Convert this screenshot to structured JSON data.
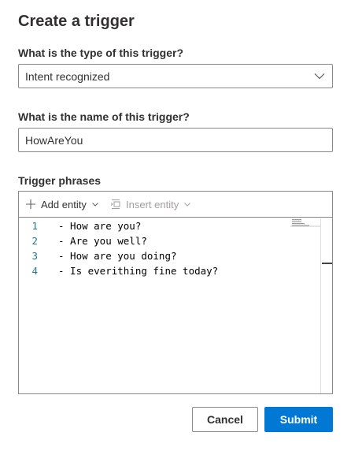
{
  "dialog": {
    "title": "Create a trigger"
  },
  "trigger_type": {
    "label": "What is the type of this trigger?",
    "value": "Intent recognized"
  },
  "trigger_name": {
    "label": "What is the name of this trigger?",
    "value": "HowAreYou"
  },
  "phrases": {
    "label": "Trigger phrases",
    "toolbar": {
      "add_entity": "Add entity",
      "insert_entity": "Insert entity"
    },
    "lines": [
      {
        "number": "1",
        "text": "- How are you?"
      },
      {
        "number": "2",
        "text": "- Are you well?"
      },
      {
        "number": "3",
        "text": "- How are you doing?"
      },
      {
        "number": "4",
        "text": "- Is everithing fine today?"
      }
    ]
  },
  "footer": {
    "cancel_label": "Cancel",
    "submit_label": "Submit"
  },
  "colors": {
    "primary": "#0078d4",
    "line_number": "#237893",
    "border": "#8a8886",
    "disabled_text": "#a19f9d"
  },
  "icons": {
    "dropdown": "chevron-down-icon",
    "add_entity": "plus-icon",
    "insert_entity": "insert-entity-icon"
  }
}
